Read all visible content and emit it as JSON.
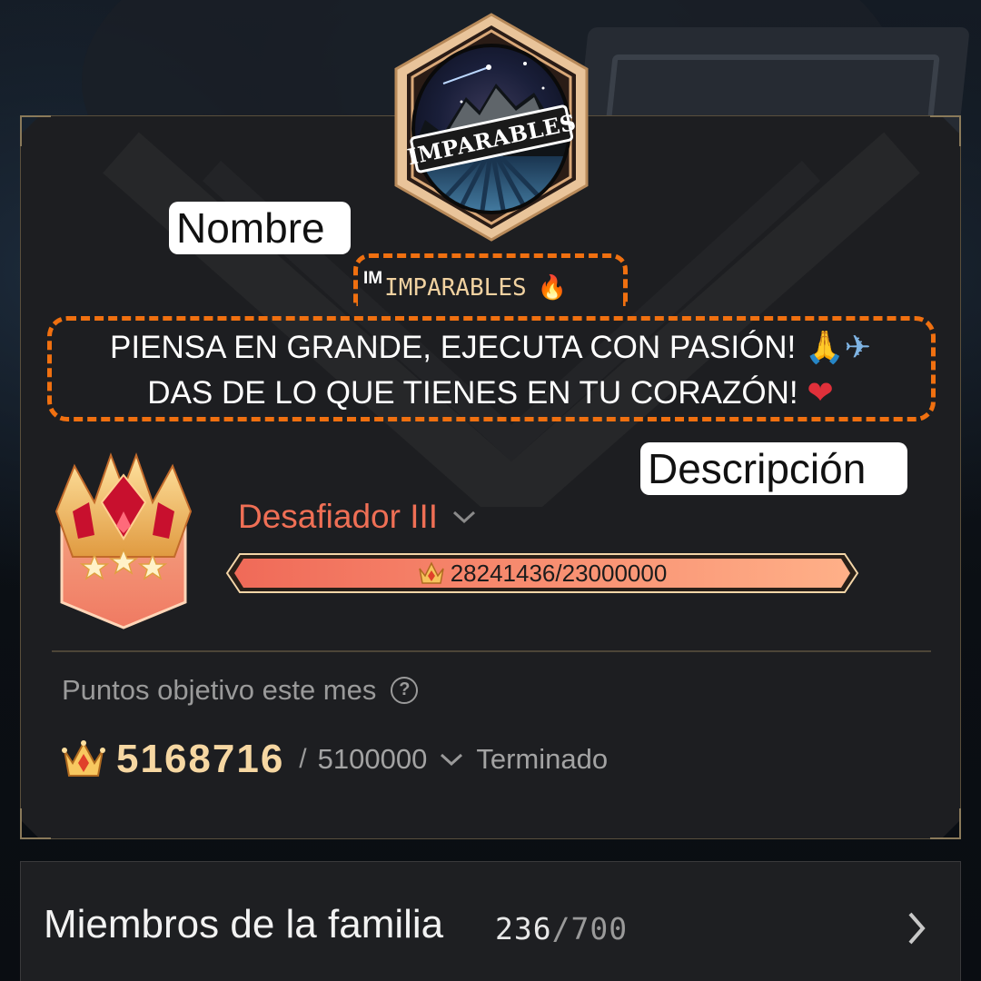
{
  "emblem": {
    "text": "IMPARABLES"
  },
  "labels": {
    "name": "Nombre",
    "description": "Descripción"
  },
  "family": {
    "tag": "IM",
    "name": "IMPARABLES",
    "name_emoji": "🔥",
    "description_line1": "PIENSA EN GRANDE, EJECUTA CON PASIÓN!",
    "description_line1_emoji1": "🙏",
    "description_line1_emoji2": "✈",
    "description_line2": "DAS DE LO QUE TIENES EN TU CORAZÓN!",
    "description_line2_emoji": "❤"
  },
  "rank": {
    "name": "Desafiador III",
    "progress_text": "28241436/23000000",
    "progress_fraction": 1.0
  },
  "monthly_target": {
    "label": "Puntos objetivo este mes",
    "help_icon": "?",
    "points": "5168716",
    "separator": "/",
    "goal": "5100000",
    "status": "Terminado"
  },
  "members": {
    "title": "Miembros de la familia",
    "current": "236",
    "max": "/700"
  },
  "colors": {
    "accent_orange": "#f07010",
    "rank_red": "#ef6f55",
    "gold": "#f6d7a2"
  },
  "icons": [
    "family-emblem-icon",
    "rank-crown-icon",
    "chevron-down-icon",
    "help-icon",
    "points-crown-icon",
    "chevron-right-icon"
  ]
}
